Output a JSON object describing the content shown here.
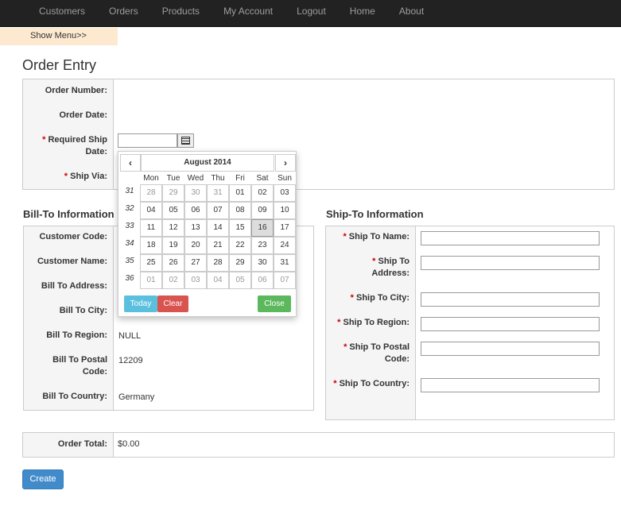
{
  "nav": [
    "Customers",
    "Orders",
    "Products",
    "My Account",
    "Logout",
    "Home",
    "About"
  ],
  "show_menu": "Show Menu>>",
  "title": "Order Entry",
  "order": {
    "order_number": "Order Number:",
    "order_date": "Order Date:",
    "required_ship_line1": "Required Ship",
    "required_ship_line2": "Date:",
    "ship_via": "Ship Via:",
    "req_mark": "*"
  },
  "billto": {
    "heading": "Bill-To Information",
    "customer_code": "Customer Code:",
    "customer_name": "Customer Name:",
    "bill_address": "Bill To Address:",
    "bill_city": "Bill To City:",
    "bill_region": "Bill To Region:",
    "bill_postal_line1": "Bill To Postal",
    "bill_postal_line2": "Code:",
    "bill_country": "Bill To Country:",
    "region_value": "NULL",
    "postal_value": "12209",
    "country_value": "Germany"
  },
  "shipto": {
    "heading": "Ship-To Information",
    "name": "Ship To Name:",
    "address_line1": "Ship To",
    "address_line2": "Address:",
    "city": "Ship To City:",
    "region": "Ship To Region:",
    "postal_line1": "Ship To Postal",
    "postal_line2": "Code:",
    "country": "Ship To Country:"
  },
  "total": {
    "label": "Order Total:",
    "value": "$0.00"
  },
  "create_label": "Create",
  "datepicker": {
    "title": "August 2014",
    "prev": "‹",
    "next": "›",
    "dow": [
      "Mon",
      "Tue",
      "Wed",
      "Thu",
      "Fri",
      "Sat",
      "Sun"
    ],
    "weeks": [
      {
        "wk": "31",
        "days": [
          "28",
          "29",
          "30",
          "31",
          "01",
          "02",
          "03"
        ],
        "out": [
          1,
          1,
          1,
          1,
          0,
          0,
          0
        ]
      },
      {
        "wk": "32",
        "days": [
          "04",
          "05",
          "06",
          "07",
          "08",
          "09",
          "10"
        ],
        "out": [
          0,
          0,
          0,
          0,
          0,
          0,
          0
        ]
      },
      {
        "wk": "33",
        "days": [
          "11",
          "12",
          "13",
          "14",
          "15",
          "16",
          "17"
        ],
        "out": [
          0,
          0,
          0,
          0,
          0,
          0,
          0
        ]
      },
      {
        "wk": "34",
        "days": [
          "18",
          "19",
          "20",
          "21",
          "22",
          "23",
          "24"
        ],
        "out": [
          0,
          0,
          0,
          0,
          0,
          0,
          0
        ]
      },
      {
        "wk": "35",
        "days": [
          "25",
          "26",
          "27",
          "28",
          "29",
          "30",
          "31"
        ],
        "out": [
          0,
          0,
          0,
          0,
          0,
          0,
          0
        ]
      },
      {
        "wk": "36",
        "days": [
          "01",
          "02",
          "03",
          "04",
          "05",
          "06",
          "07"
        ],
        "out": [
          1,
          1,
          1,
          1,
          1,
          1,
          1
        ]
      }
    ],
    "selected_day": "16",
    "today_label": "Today",
    "clear_label": "Clear",
    "close_label": "Close"
  }
}
